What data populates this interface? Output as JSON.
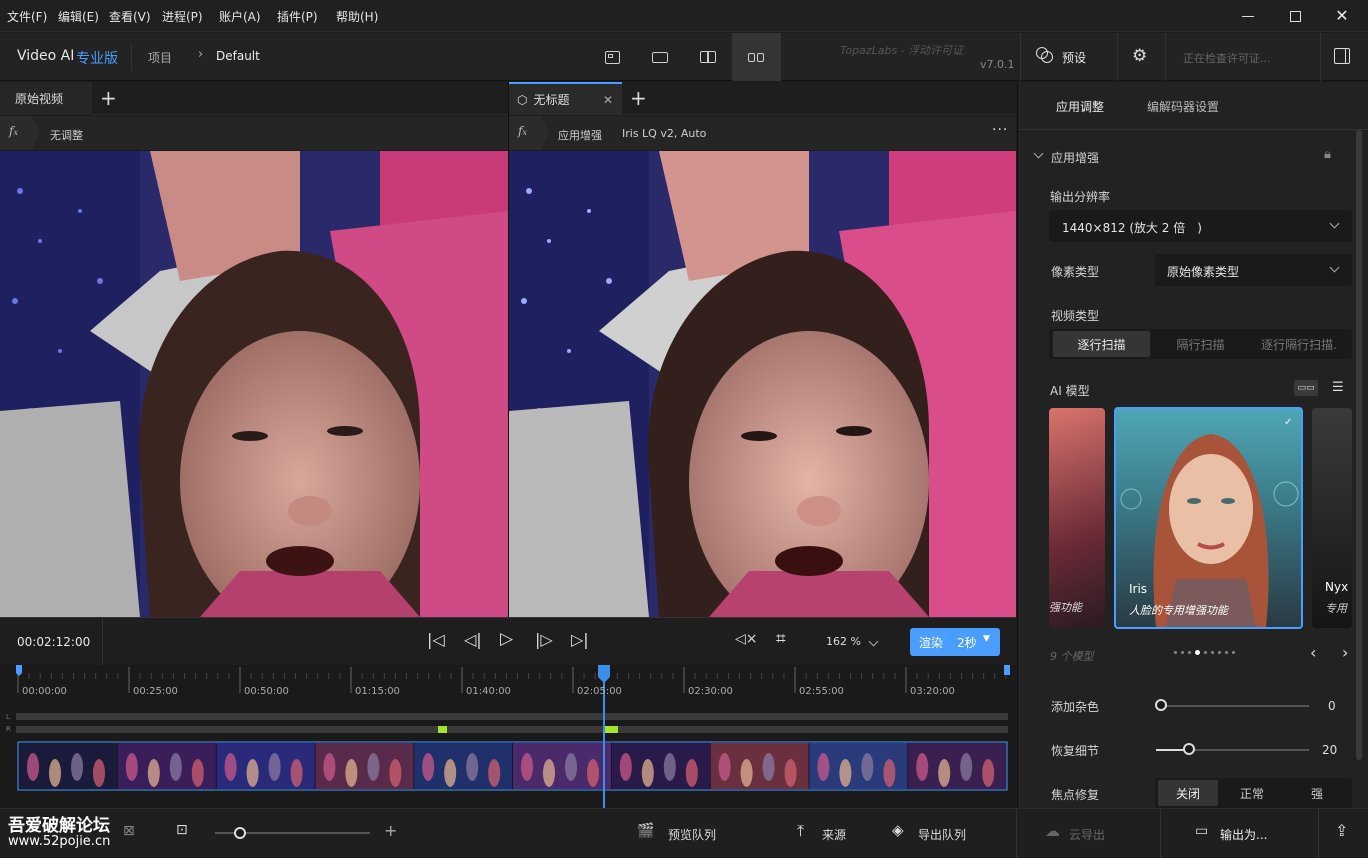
{
  "menu": [
    "文件(F)",
    "编辑(E)",
    "查看(V)",
    "进程(P)",
    "账户(A)",
    "插件(P)",
    "帮助(H)"
  ],
  "app": {
    "name": "Video AI",
    "edition": "专业版",
    "project": "项目",
    "crumb": "Default",
    "watermark": "TopazLabs - 浮动许可证",
    "version": "v7.0.1",
    "preset": "预设",
    "license_search": "正在检查许可证..."
  },
  "tabs": {
    "original": "原始视频",
    "untitled": "无标题"
  },
  "left_fx": {
    "label": "无调整"
  },
  "right_fx": {
    "label": "应用增强",
    "model": "Iris LQ v2, Auto"
  },
  "controls": {
    "timecode": "00:02:12:00",
    "zoom": "162 %",
    "render": "渲染",
    "render_time": "2秒"
  },
  "timeline": {
    "ticks": [
      "00:00:00",
      "00:25:00",
      "00:50:00",
      "01:15:00",
      "01:40:00",
      "02:05:00",
      "02:30:00",
      "02:55:00",
      "03:20:00"
    ],
    "lr": [
      "L",
      "R"
    ]
  },
  "bottom": {
    "preview_queue": "预览队列",
    "source": "来源",
    "export_queue": "导出队列",
    "cloud_export": "云导出",
    "export_as": "输出为...",
    "watermark1": "吾爱破解论坛",
    "watermark2": "www.52pojie.cn"
  },
  "panel": {
    "tab_apply": "应用调整",
    "tab_codec": "编解码器设置",
    "section": "应用增强",
    "output_res_label": "输出分辨率",
    "output_res": "1440×812 (放大 2 倍　)",
    "pixel_type_label": "像素类型",
    "pixel_type": "原始像素类型",
    "video_type_label": "视频类型",
    "video_types": [
      "逐行扫描",
      "隔行扫描",
      "逐行隔行扫描."
    ],
    "ai_model_label": "AI 模型",
    "model_count": "9 个模型",
    "model_left_caption": "强功能",
    "model_center_name": "Iris",
    "model_center_desc": "人脸的专用增强功能",
    "model_right_name": "Nyx",
    "model_right_desc": "专用",
    "add_noise_label": "添加杂色",
    "add_noise": "0",
    "recover_label": "恢复细节",
    "recover": "20",
    "focus_label": "焦点修复",
    "focus_opts": [
      "关闭",
      "正常",
      "强"
    ]
  },
  "colors": {
    "accent": "#4a9eff",
    "playhead": "#3d8eea",
    "green": "#a4e62a"
  }
}
